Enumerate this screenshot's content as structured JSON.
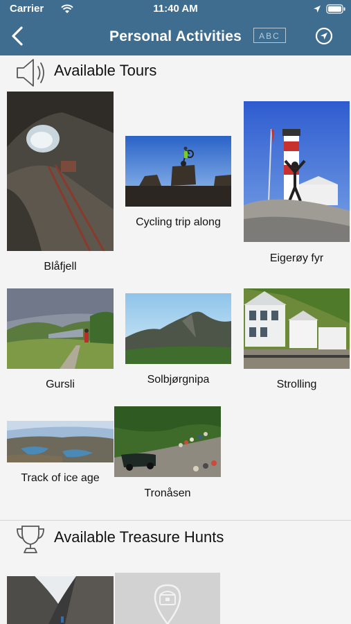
{
  "status": {
    "carrier": "Carrier",
    "time": "11:40 AM"
  },
  "nav": {
    "title": "Personal Activities",
    "abc": "ABC"
  },
  "tours": {
    "heading": "Available Tours",
    "items": [
      {
        "label": "Blåfjell"
      },
      {
        "label": "Cycling trip along"
      },
      {
        "label": "Eigerøy fyr"
      },
      {
        "label": "Gursli"
      },
      {
        "label": "Solbjørgnipa"
      },
      {
        "label": "Strolling"
      },
      {
        "label": "Track of ice age"
      },
      {
        "label": "Tronåsen"
      }
    ]
  },
  "treasure": {
    "heading": "Available Treasure Hunts"
  },
  "icons": {
    "back": "chevron-left-icon",
    "location": "location-arrow-icon",
    "speaker": "speaker-icon",
    "trophy": "trophy-icon",
    "wifi": "wifi-icon",
    "battery": "battery-icon",
    "placeholder": "treasure-chest-pin-icon"
  },
  "colors": {
    "nav": "#3f6d8f",
    "background": "#f4f4f4"
  }
}
